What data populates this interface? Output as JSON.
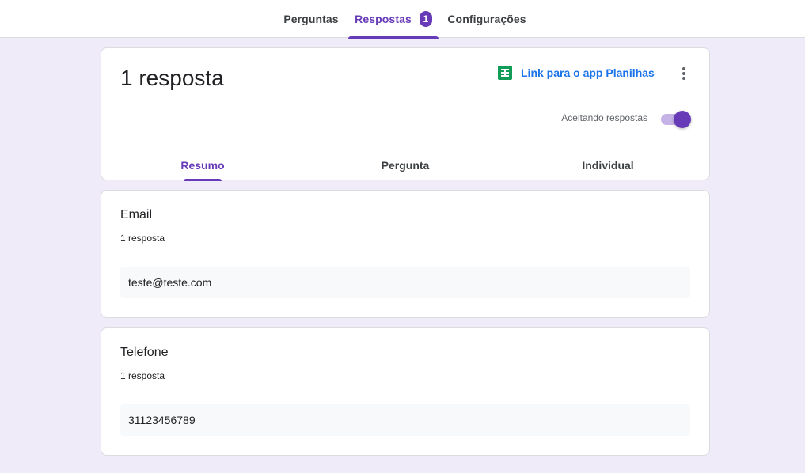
{
  "top_tabs": [
    {
      "label": "Perguntas"
    },
    {
      "label": "Respostas",
      "badge": "1"
    },
    {
      "label": "Configurações"
    }
  ],
  "summary": {
    "title": "1 resposta",
    "sheets_link": "Link para o app Planilhas",
    "accepting_label": "Aceitando respostas",
    "accepting": true,
    "sub_tabs": [
      "Resumo",
      "Pergunta",
      "Individual"
    ]
  },
  "questions": [
    {
      "title": "Email",
      "count": "1 resposta",
      "answer": "teste@teste.com"
    },
    {
      "title": "Telefone",
      "count": "1 resposta",
      "answer": "31123456789"
    }
  ],
  "colors": {
    "accent": "#673ab7",
    "link": "#1a73e8",
    "background": "#f0ebf8",
    "sheets_icon": "#0f9d58"
  },
  "icons": [
    "sheets-icon",
    "more-vert-icon"
  ]
}
